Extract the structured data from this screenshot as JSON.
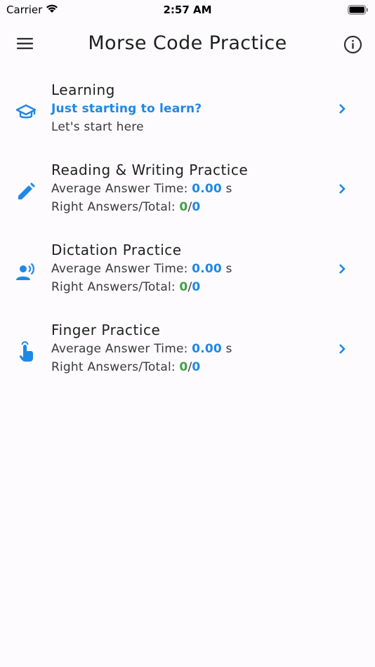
{
  "status_bar": {
    "carrier": "Carrier",
    "time": "2:57 AM"
  },
  "app_bar": {
    "title": "Morse Code Practice",
    "menu_icon": "hamburger-menu-icon",
    "info_icon": "info-circle-icon"
  },
  "colors": {
    "accent_blue": "#1e88e5",
    "success_green": "#43a047"
  },
  "items": [
    {
      "title": "Learning",
      "icon": "graduation-cap-icon",
      "subtitle": "Just starting to learn?",
      "description": "Let's start here"
    },
    {
      "title": "Reading & Writing Practice",
      "icon": "pencil-icon",
      "time_label": "Average Answer Time:",
      "time_value": "0.00",
      "time_unit": "s",
      "answers_label": "Right Answers/Total:",
      "right": "0",
      "separator": "/",
      "total": "0"
    },
    {
      "title": "Dictation Practice",
      "icon": "person-speaking-icon",
      "time_label": "Average Answer Time:",
      "time_value": "0.00",
      "time_unit": "s",
      "answers_label": "Right Answers/Total:",
      "right": "0",
      "separator": "/",
      "total": "0"
    },
    {
      "title": "Finger Practice",
      "icon": "touch-finger-icon",
      "time_label": "Average Answer Time:",
      "time_value": "0.00",
      "time_unit": "s",
      "answers_label": "Right Answers/Total:",
      "right": "0",
      "separator": "/",
      "total": "0"
    }
  ]
}
